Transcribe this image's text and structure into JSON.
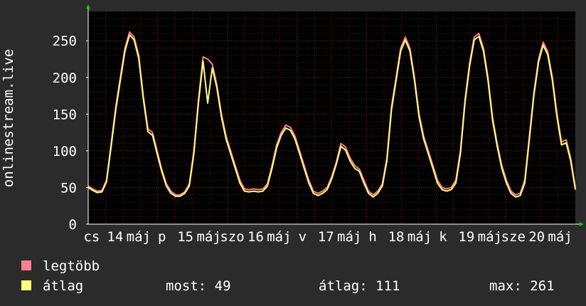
{
  "colors": {
    "background": "#2b2b2b",
    "plot_background": "#000000",
    "grid_minor": "#5a1a1a",
    "grid_major": "#7a2a2a",
    "axis": "#ffffff",
    "arrow": "#00cc00",
    "max_series": "#ff7f8f",
    "avg_series": "#ffff80"
  },
  "chart_data": {
    "type": "line",
    "ylabel": "onlinestream.live",
    "ylim": [
      0,
      290
    ],
    "yticks": [
      0,
      50,
      100,
      150,
      200,
      250
    ],
    "grid": true,
    "x_tick_labels": [
      "cs",
      "14",
      "máj",
      "p",
      "15",
      "máj",
      "szo",
      "16",
      "máj",
      "v",
      "17",
      "máj",
      "h",
      "18",
      "máj",
      "k",
      "19",
      "máj",
      "sze",
      "20",
      "máj"
    ],
    "days_covered": 7,
    "series": [
      {
        "name": "legtöbb",
        "color": "#ff7f8f",
        "values": [
          52,
          48,
          45,
          46,
          60,
          110,
          160,
          200,
          240,
          262,
          255,
          230,
          175,
          130,
          125,
          100,
          75,
          55,
          45,
          40,
          40,
          44,
          55,
          100,
          170,
          228,
          225,
          218,
          190,
          150,
          120,
          100,
          80,
          60,
          48,
          47,
          48,
          47,
          48,
          55,
          80,
          108,
          125,
          135,
          132,
          120,
          100,
          80,
          60,
          45,
          42,
          45,
          50,
          65,
          85,
          110,
          105,
          90,
          80,
          75,
          60,
          45,
          40,
          45,
          55,
          90,
          160,
          200,
          240,
          255,
          240,
          200,
          150,
          120,
          100,
          80,
          60,
          50,
          48,
          50,
          60,
          100,
          170,
          220,
          255,
          260,
          240,
          200,
          145,
          110,
          80,
          60,
          45,
          40,
          42,
          60,
          120,
          180,
          225,
          248,
          235,
          200,
          150,
          112,
          115,
          90,
          50
        ]
      },
      {
        "name": "átlag",
        "color": "#ffff80",
        "values": [
          50,
          46,
          43,
          44,
          58,
          106,
          156,
          196,
          236,
          258,
          251,
          226,
          171,
          126,
          121,
          96,
          72,
          52,
          42,
          38,
          38,
          42,
          52,
          96,
          166,
          222,
          165,
          213,
          186,
          146,
          116,
          96,
          76,
          56,
          45,
          44,
          45,
          44,
          45,
          52,
          76,
          104,
          121,
          131,
          128,
          116,
          96,
          76,
          56,
          42,
          39,
          42,
          47,
          62,
          82,
          106,
          101,
          86,
          76,
          72,
          56,
          42,
          37,
          42,
          52,
          86,
          156,
          196,
          236,
          251,
          236,
          196,
          146,
          116,
          96,
          76,
          56,
          47,
          45,
          47,
          56,
          96,
          166,
          216,
          251,
          256,
          236,
          196,
          141,
          106,
          76,
          56,
          42,
          37,
          39,
          56,
          116,
          176,
          221,
          244,
          231,
          196,
          146,
          108,
          111,
          86,
          47
        ]
      }
    ]
  },
  "legend": {
    "items": [
      {
        "label": "legtöbb",
        "color": "#ff7f8f"
      },
      {
        "label": "átlag",
        "color": "#ffff80"
      }
    ],
    "stats": [
      {
        "key": "most:",
        "value": "49"
      },
      {
        "key": "átlag:",
        "value": "111"
      },
      {
        "key": "max:",
        "value": "261"
      }
    ]
  }
}
